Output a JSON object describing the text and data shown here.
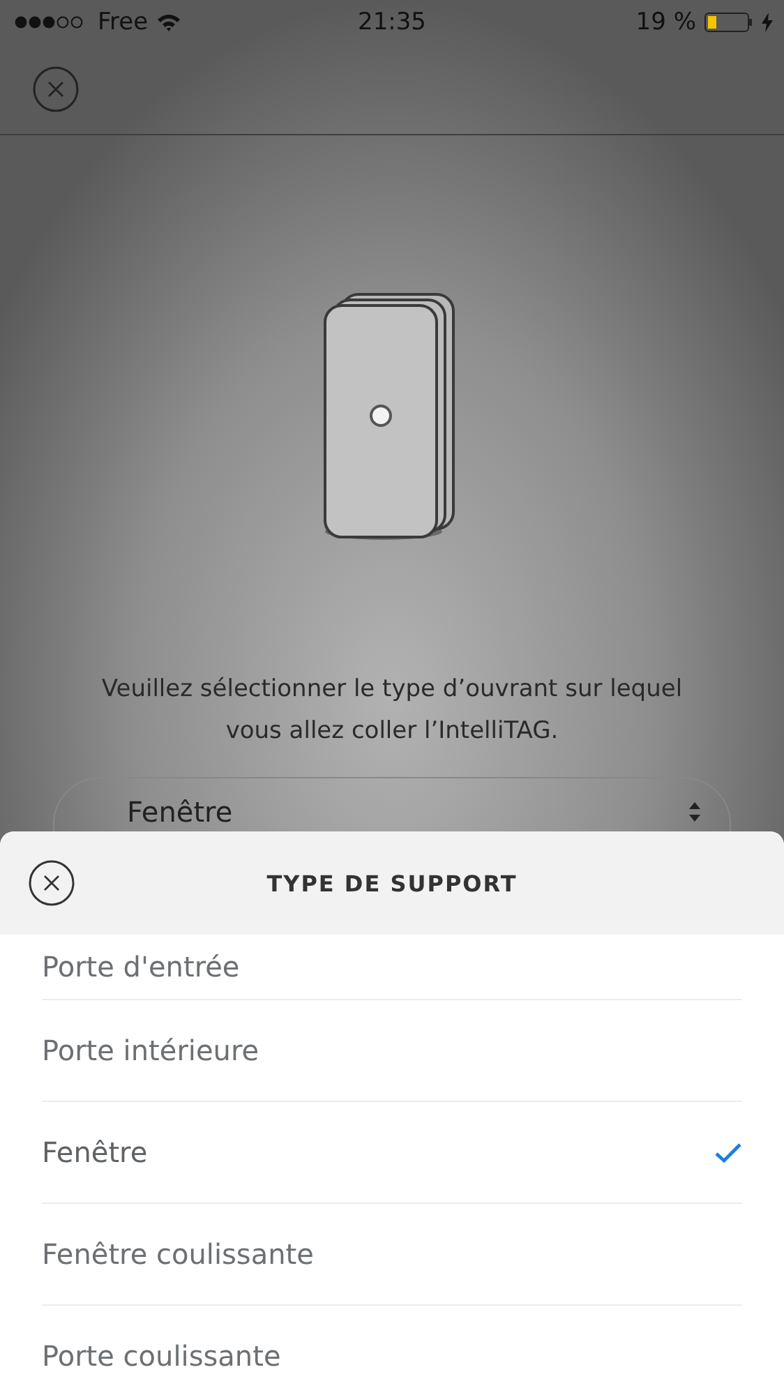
{
  "status_bar": {
    "carrier": "Free",
    "time": "21:35",
    "battery": "19 %"
  },
  "page": {
    "instruction": "Veuillez sélectionner le type d’ouvrant sur lequel vous allez coller l’IntelliTAG.",
    "dropdown": {
      "value": "Fenêtre"
    }
  },
  "sheet": {
    "title": "TYPE DE SUPPORT",
    "options": [
      {
        "label": "Porte d'entrée",
        "selected": false
      },
      {
        "label": "Porte intérieure",
        "selected": false
      },
      {
        "label": "Fenêtre",
        "selected": true
      },
      {
        "label": "Fenêtre coulissante",
        "selected": false
      },
      {
        "label": "Porte coulissante",
        "selected": false
      }
    ]
  }
}
